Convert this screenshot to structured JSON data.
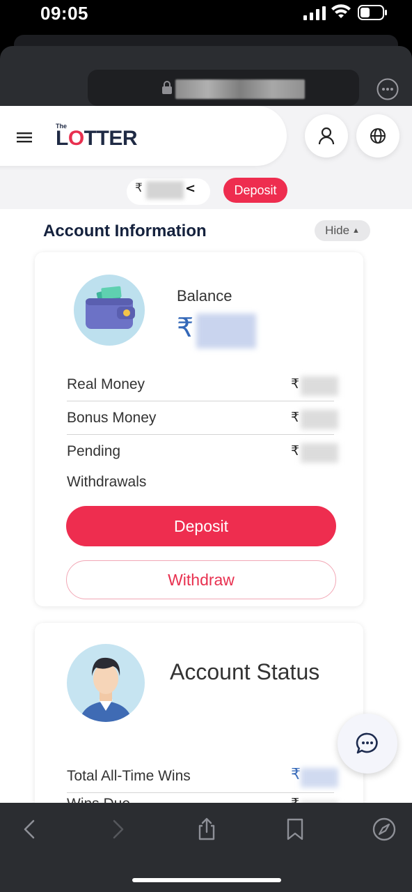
{
  "status_bar": {
    "time": "09:05"
  },
  "browser": {
    "url_blurred": true
  },
  "header": {
    "logo_small": "The",
    "logo_l": "L",
    "logo_o": "O",
    "logo_rest": "TTER",
    "currency_symbol": "₹",
    "collapse_glyph": "<",
    "deposit_chip": "Deposit"
  },
  "account_info": {
    "title": "Account Information",
    "hide_label": "Hide",
    "hide_glyph": "▲",
    "balance_label": "Balance",
    "balance_symbol": "₹",
    "rows": [
      {
        "label": "Real Money",
        "symbol": "₹"
      },
      {
        "label": "Bonus Money",
        "symbol": "₹"
      },
      {
        "label": "Pending",
        "label_line2": "Withdrawals",
        "symbol": "₹"
      }
    ],
    "deposit_button": "Deposit",
    "withdraw_button": "Withdraw"
  },
  "account_status": {
    "title": "Account Status",
    "rows": [
      {
        "label": "Total All-Time Wins",
        "symbol": "₹"
      },
      {
        "label": "Wins Due",
        "symbol": "₹"
      }
    ]
  },
  "colors": {
    "brand_red": "#ee2d4f",
    "navy": "#14213d",
    "rupee_blue": "#3468b8",
    "browser_chrome": "#2b2d31"
  }
}
